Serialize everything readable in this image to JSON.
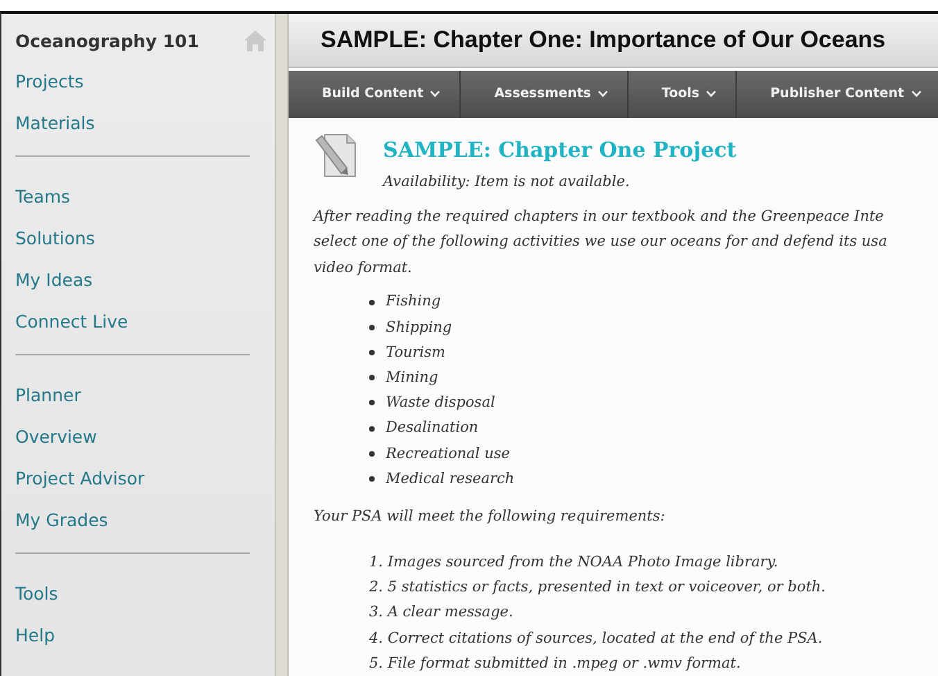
{
  "sidebar": {
    "course_title": "Oceanography 101",
    "groups": [
      {
        "items": [
          {
            "label": "Projects"
          },
          {
            "label": "Materials"
          }
        ]
      },
      {
        "items": [
          {
            "label": "Teams"
          },
          {
            "label": "Solutions"
          },
          {
            "label": "My Ideas"
          },
          {
            "label": "Connect Live"
          }
        ]
      },
      {
        "items": [
          {
            "label": "Planner"
          },
          {
            "label": "Overview"
          },
          {
            "label": "Project Advisor"
          },
          {
            "label": "My Grades"
          }
        ]
      },
      {
        "items": [
          {
            "label": "Tools"
          },
          {
            "label": "Help"
          }
        ]
      }
    ]
  },
  "page_title": "SAMPLE: Chapter One: Importance of Our Oceans",
  "menu": [
    {
      "label": "Build Content"
    },
    {
      "label": "Assessments"
    },
    {
      "label": "Tools"
    },
    {
      "label": "Publisher Content"
    }
  ],
  "item": {
    "title": "SAMPLE: Chapter One Project",
    "availability": "Availability:  Item is not available.",
    "paragraph_lines": [
      "After reading the required chapters in our textbook and the Greenpeace Inte",
      "select one of the following activities we use our oceans for and defend its usa",
      "video format."
    ],
    "activities": [
      "Fishing",
      "Shipping",
      "Tourism",
      "Mining",
      "Waste disposal",
      "Desalination",
      "Recreational use",
      "Medical research"
    ],
    "requirements_intro": "Your PSA will meet the following requirements:",
    "requirements": [
      {
        "number": "1.",
        "text": "Images sourced from the NOAA Photo Image library."
      },
      {
        "number": "2.",
        "text": "5 statistics or facts, presented in text or voiceover, or both."
      },
      {
        "number": "3.",
        "text": "A clear message."
      },
      {
        "number": "4.",
        "text": "Correct citations of sources, located at the end of the PSA."
      },
      {
        "number": "5.",
        "text": "File format submitted in .mpeg or .wmv format."
      }
    ]
  }
}
